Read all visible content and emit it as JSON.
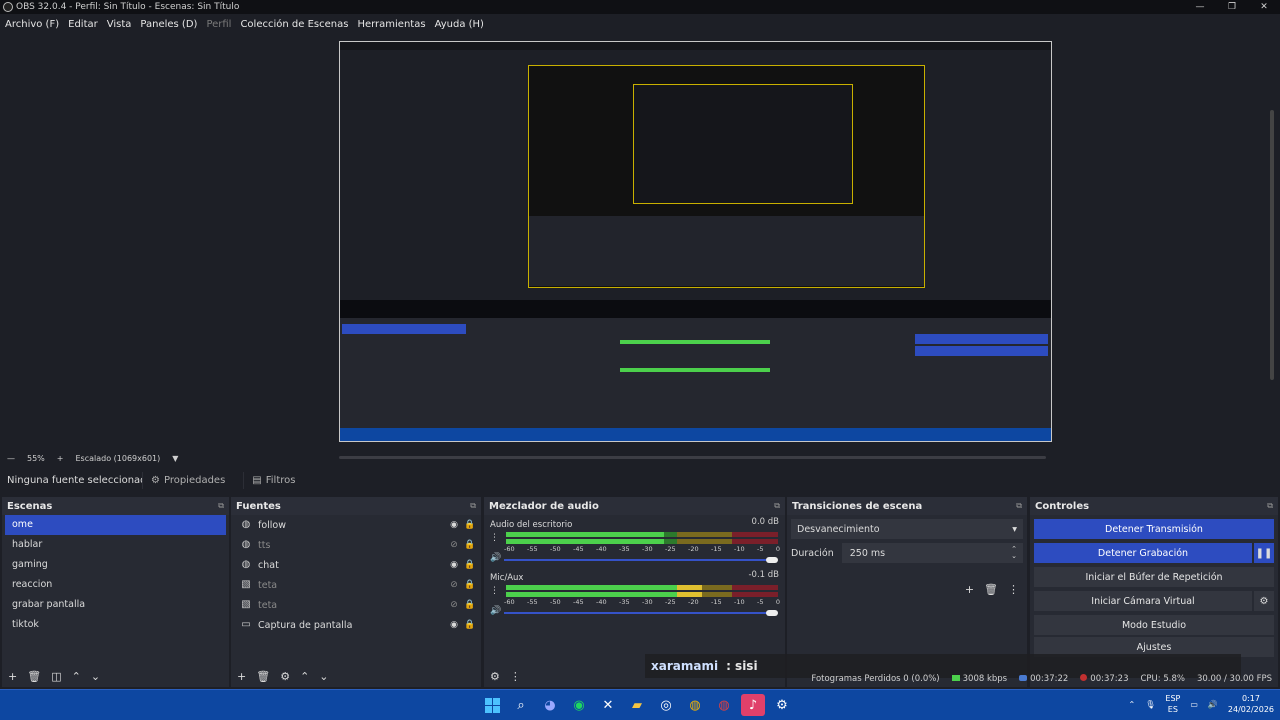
{
  "window": {
    "title": "OBS 32.0.4 - Perfil: Sin Título - Escenas: Sin Título",
    "min": "—",
    "max": "❐",
    "close": "✕"
  },
  "menu": {
    "items": [
      "Archivo (F)",
      "Editar",
      "Vista",
      "Paneles (D)",
      "Perfil",
      "Colección de Escenas",
      "Herramientas",
      "Ayuda (H)"
    ]
  },
  "zoom": {
    "dash": "—",
    "level": "55%",
    "plus": "+",
    "scale": "Escalado (1069x601)"
  },
  "props_bar": {
    "no_source": "Ninguna fuente seleccionada",
    "properties": "Propiedades",
    "filters": "Filtros"
  },
  "scenes": {
    "title": "Escenas",
    "items": [
      "ome",
      "hablar",
      "gaming",
      "reaccion",
      "grabar pantalla",
      "tiktok"
    ],
    "active_index": 0
  },
  "sources": {
    "title": "Fuentes",
    "items": [
      {
        "name": "follow",
        "icon": "globe-icon",
        "visible": true,
        "locked": true
      },
      {
        "name": "tts",
        "icon": "globe-icon",
        "visible": false,
        "locked": true
      },
      {
        "name": "chat",
        "icon": "globe-icon",
        "visible": true,
        "locked": true
      },
      {
        "name": "teta",
        "icon": "image-icon",
        "visible": false,
        "locked": true
      },
      {
        "name": "teta",
        "icon": "image-icon",
        "visible": false,
        "locked": true
      },
      {
        "name": "Captura de pantalla",
        "icon": "monitor-icon",
        "visible": true,
        "locked": true
      }
    ]
  },
  "mixer": {
    "title": "Mezclador de audio",
    "channels": [
      {
        "name": "Audio del escritorio",
        "db": "0.0 dB",
        "level": 0.58,
        "volume": 1.0
      },
      {
        "name": "Mic/Aux",
        "db": "-0.1 dB",
        "level": 0.72,
        "volume": 1.0
      }
    ],
    "ticks": [
      "-60",
      "-55",
      "-50",
      "-45",
      "-40",
      "-35",
      "-30",
      "-25",
      "-20",
      "-15",
      "-10",
      "-5",
      "0"
    ]
  },
  "transitions": {
    "title": "Transiciones de escena",
    "selected": "Desvanecimiento",
    "duration_label": "Duración",
    "duration_value": "250 ms"
  },
  "controls": {
    "title": "Controles",
    "stop_stream": "Detener Transmisión",
    "stop_record": "Detener Grabación",
    "replay_buffer": "Iniciar el Búfer de Repetición",
    "virtual_cam": "Iniciar Cámara Virtual",
    "studio_mode": "Modo Estudio",
    "settings": "Ajustes"
  },
  "status": {
    "dropped": "Fotogramas Perdidos 0 (0.0%)",
    "bitrate": "3008 kbps",
    "stream_time": "00:37:22",
    "rec_time": "00:37:23",
    "cpu": "CPU: 5.8%",
    "fps": "30.00 / 30.00 FPS"
  },
  "chat_overlay": {
    "user": "xaramami",
    "message": ": sisi"
  },
  "taskbar": {
    "lang_top": "ESP",
    "lang_bottom": "ES",
    "time": "0:17",
    "date": "24/02/2026"
  }
}
